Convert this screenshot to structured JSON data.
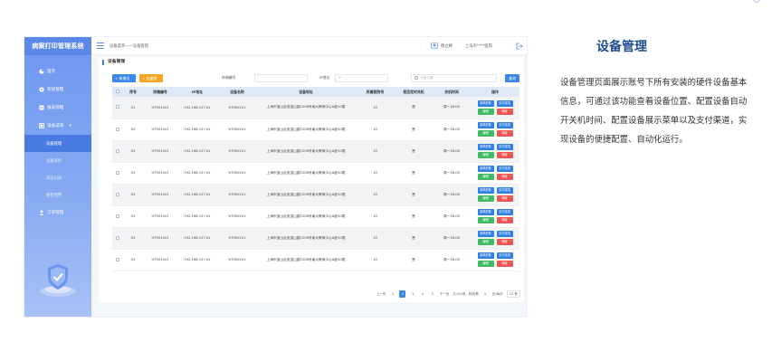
{
  "app": {
    "title": "病案打印管理系统",
    "breadcrumb": "设备菜单——设备管理",
    "user": "周立婷",
    "hospital": "上海市****医院"
  },
  "sidebar": {
    "items": [
      {
        "label": "首页"
      },
      {
        "label": "系统管理"
      },
      {
        "label": "报表管理"
      },
      {
        "label": "设备菜单"
      },
      {
        "label": "设备管理"
      },
      {
        "label": "设备监控"
      },
      {
        "label": "日志记录"
      },
      {
        "label": "报警预警"
      },
      {
        "label": "订单管理"
      }
    ]
  },
  "page": {
    "title": "设备管理",
    "add_button": "+ 新增设备",
    "batch_button": "+ 批量操作",
    "filter_terminal_label": "终端编号",
    "filter_ip_label": "IP地址",
    "filter_ip_placeholder": "IP",
    "filter_location_placeholder": "设备位置",
    "search_button": "查询"
  },
  "table": {
    "headers": [
      "",
      "序号",
      "终端编号",
      "IP地址",
      "设备名称",
      "设备地址",
      "所属医院号",
      "是否定时关机",
      "关机时间",
      "操作"
    ],
    "rows": [
      {
        "no": "01",
        "terminal": "HT001001",
        "ip": "192.168.157.01",
        "name": "HT000101",
        "address": "上海市宝山区淞温山路1508号南大教育中心A座10楼",
        "hospital_no": "10",
        "timed_off": "是",
        "off_time": "周一18:00"
      },
      {
        "no": "02",
        "terminal": "HT001001",
        "ip": "192.168.157.01",
        "name": "HT000101",
        "address": "上海市宝山区淞温山路1508号南大教育中心A座10楼",
        "hospital_no": "10",
        "timed_off": "是",
        "off_time": "周一18:00"
      },
      {
        "no": "03",
        "terminal": "HT001001",
        "ip": "192.168.157.01",
        "name": "HT000101",
        "address": "上海市宝山区淞温山路1508号南大教育中心A座10楼",
        "hospital_no": "10",
        "timed_off": "是",
        "off_time": "周一18:00"
      },
      {
        "no": "03",
        "terminal": "HT001001",
        "ip": "192.168.157.01",
        "name": "HT000101",
        "address": "上海市宝山区淞温山路1508号南大教育中心A座10楼",
        "hospital_no": "10",
        "timed_off": "是",
        "off_time": "周一18:00"
      },
      {
        "no": "03",
        "terminal": "HT001001",
        "ip": "192.168.157.01",
        "name": "HT000101",
        "address": "上海市宝山区淞温山路1508号南大教育中心A座10楼",
        "hospital_no": "10",
        "timed_off": "是",
        "off_time": "周一18:00"
      },
      {
        "no": "03",
        "terminal": "HT001001",
        "ip": "192.168.157.01",
        "name": "HT000101",
        "address": "上海市宝山区淞温山路1508号南大教育中心A座10楼",
        "hospital_no": "10",
        "timed_off": "是",
        "off_time": "周一18:00"
      },
      {
        "no": "03",
        "terminal": "HT001001",
        "ip": "192.168.157.01",
        "name": "HT000101",
        "address": "上海市宝山区淞温山路1508号南大教育中心A座10楼",
        "hospital_no": "10",
        "timed_off": "是",
        "off_time": "周一18:00"
      },
      {
        "no": "03",
        "terminal": "HT001001",
        "ip": "192.168.157.01",
        "name": "HT000101",
        "address": "上海市宝山区淞温山路1508号南大教育中心A座10楼",
        "hospital_no": "10",
        "timed_off": "是",
        "off_time": "周一18:00"
      }
    ],
    "actions": {
      "config": "菜单配置",
      "pay": "支付渠道",
      "edit": "编辑",
      "delete": "删除"
    }
  },
  "pagination": {
    "prev": "上一页",
    "pages": [
      "1",
      "2",
      "3",
      "4",
      "5"
    ],
    "current": "2",
    "next": "下一页",
    "total": "共100条，转到第",
    "goto": "5",
    "page_unit": "页/每页",
    "size": "10 条"
  },
  "description": {
    "title": "设备管理",
    "text": "设备管理页面展示账号下所有安装的硬件设备基本信息，可通过该功能查看设备位置、配置设备自动开关机时间、配置设备展示菜单以及支付渠道，实现设备的便捷配置、自动化运行。"
  },
  "colors": {
    "accent": "#3c86e8",
    "sidebar": "#6e98ef",
    "title": "#1f4e8f"
  }
}
